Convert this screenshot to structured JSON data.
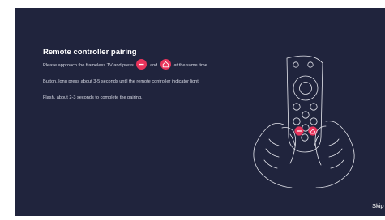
{
  "pairing": {
    "title": "Remote controller pairing",
    "line1_before": "Please approach the frameless TV and press",
    "line1_and": "and",
    "line1_after": "at the same time",
    "line2": "Button, long press about 3-5 seconds until the remote controller indicator light",
    "line3": "Flash, about 2-3 seconds to complete the pairing."
  },
  "icons": {
    "key1": "back-key-icon",
    "key2": "home-key-icon",
    "illustration": "remote-in-hands-illustration"
  },
  "colors": {
    "background": "#20243d",
    "accent": "#e8345c",
    "text": "#ffffff"
  },
  "skip_label": "Skip"
}
